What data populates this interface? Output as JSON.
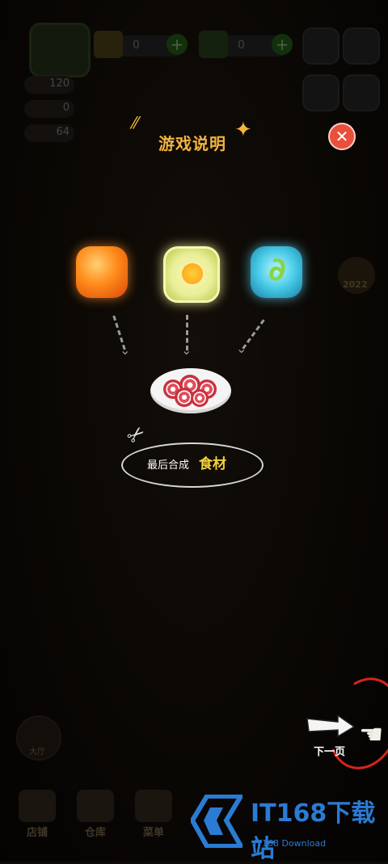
{
  "top_bar": {
    "coins": "0",
    "cash": "0"
  },
  "stats": {
    "coins_value": "120",
    "customers_value": "0",
    "orders_value": "64"
  },
  "dialog": {
    "title": "游戏说明",
    "close_symbol": "✕",
    "caption_prefix": "最后合成",
    "caption_highlight": "食材"
  },
  "next": {
    "label": "下一页"
  },
  "side_badge": "2022",
  "bottom_nav": [
    {
      "label": "店铺"
    },
    {
      "label": "仓库"
    },
    {
      "label": "菜单"
    }
  ],
  "left_menu": {
    "hall_label": "大厅"
  },
  "watermark": {
    "title": "IT168下载站",
    "subtitle": "IT168 Download"
  },
  "colors": {
    "title": "#f3b43c",
    "accent_text": "#f6d33a",
    "close": "#e8503c",
    "next_circle": "#d9241b",
    "watermark": "#2a7bd3"
  }
}
